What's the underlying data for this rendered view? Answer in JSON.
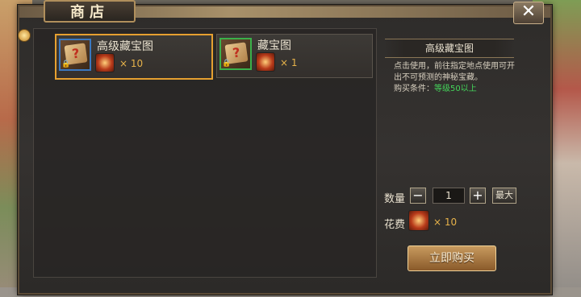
{
  "window": {
    "title": "商店",
    "close_label": "✕"
  },
  "items": [
    {
      "name": "高级藏宝图",
      "qty_text": "× 10"
    },
    {
      "name": "藏宝图",
      "qty_text": "× 1"
    }
  ],
  "detail": {
    "title": "高级藏宝图",
    "description": "点击使用，前往指定地点使用可开出不可预测的神秘宝藏。",
    "condition_label": "购买条件：",
    "condition_value": "等级50以上"
  },
  "purchase": {
    "qty_label": "数量",
    "quantity": "1",
    "minus_label": "−",
    "plus_label": "+",
    "max_label": "最大",
    "cost_label": "花费",
    "cost_qty": "× 10",
    "buy_label": "立即购买"
  },
  "colors": {
    "selected_border": "#e6a030",
    "condition_value": "#44d35a",
    "quantity_accent": "#e6b24a"
  }
}
